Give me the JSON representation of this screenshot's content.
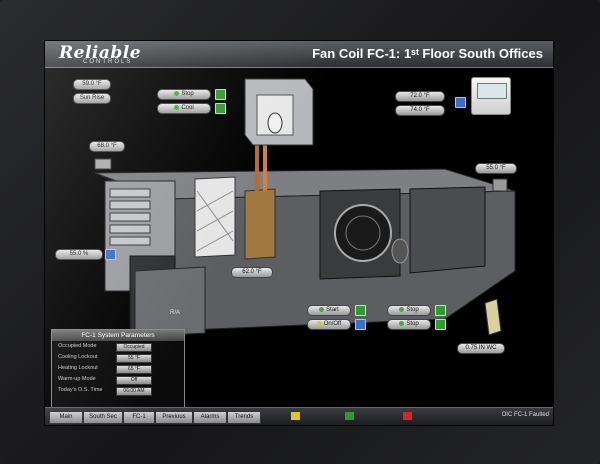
{
  "header": {
    "logo_text": "Reliable",
    "logo_sub": "CONTROLS",
    "title": "Fan Coil FC-1: 1ˢᵗ Floor South Offices"
  },
  "labels": {
    "oa_temp": "59.0 °F",
    "oa_status": "Sun Rise",
    "hv_stop": "Stop",
    "hv_cool": "Cool",
    "zone_temp": "72.0 °F",
    "zone_setpt": "74.0 °F",
    "ra_temp": "68.0 °F",
    "ra_hum": "55.0 %",
    "ma_temp": "62.0 °F",
    "sa_temp": "55.0 °F",
    "fan_start": "Start",
    "fan_stop": "Stop",
    "fan_on": "On/Off",
    "fan_stop2": "Stop",
    "ra_tag": "R/A",
    "static_pressure": "0.75 IN WC"
  },
  "panel": {
    "title": "FC-1 System Parameters",
    "rows": [
      {
        "label": "Occupied Mode",
        "value": "Occupied"
      },
      {
        "label": "Cooling Lockout",
        "value": "55 °F"
      },
      {
        "label": "Heating Lockout",
        "value": "65 °F"
      },
      {
        "label": "Warm-up Mode",
        "value": "Off"
      },
      {
        "label": "Today's O.S. Time",
        "value": "06:00 AM"
      }
    ]
  },
  "nav": {
    "tabs": [
      "Main",
      "South Sec",
      "FC-1",
      "Previous",
      "Alarms",
      "Trends"
    ],
    "footer": "OIC FC-1 Faulted"
  },
  "colors": {
    "accent_green": "#2f9a2f",
    "accent_blue": "#3a6fc8",
    "alarm_red": "#d8252a",
    "alarm_yellow": "#e6c229"
  }
}
